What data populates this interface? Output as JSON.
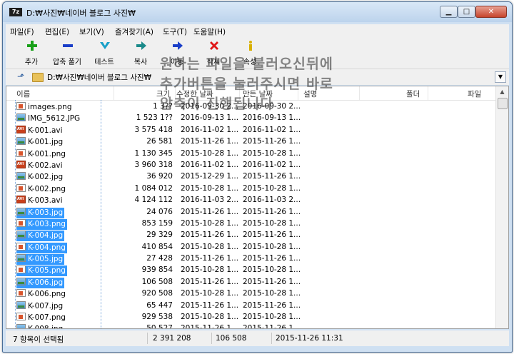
{
  "window": {
    "title": "D:₩사진₩네이버 블로그 사진₩",
    "app_icon": "7z"
  },
  "menu": [
    "파일(F)",
    "편집(E)",
    "보기(V)",
    "즐겨찾기(A)",
    "도구(T)",
    "도움말(H)"
  ],
  "toolbar": [
    {
      "label": "추가",
      "icon": "add-icon",
      "color": "#18a018"
    },
    {
      "label": "압축 풀기",
      "icon": "extract-icon",
      "color": "#1a3ec8"
    },
    {
      "label": "테스트",
      "icon": "test-icon",
      "color": "#18a0c8"
    },
    {
      "label": "복사",
      "icon": "copy-icon",
      "color": "#1a8a8a"
    },
    {
      "label": "이동",
      "icon": "move-icon",
      "color": "#1a3ec8"
    },
    {
      "label": "삭제",
      "icon": "delete-icon",
      "color": "#e01818"
    },
    {
      "label": "속성",
      "icon": "info-icon",
      "color": "#d8b000"
    }
  ],
  "address": {
    "path": "D:₩사진₩네이버 블로그 사진₩"
  },
  "columns": {
    "name": "이름",
    "size": "크기",
    "modified": "수정한 날짜",
    "created": "만든 날짜",
    "comment": "설명",
    "folders": "폴더",
    "files": "파일"
  },
  "files": [
    {
      "name": "images.png",
      "type": "png",
      "size": "1 3??",
      "modified": "2016-09-30 2...",
      "created": "2016-09-30 2...",
      "selected": false
    },
    {
      "name": "IMG_5612.JPG",
      "type": "jpg",
      "size": "1 523 1??",
      "modified": "2016-09-13 1...",
      "created": "2016-09-13 1...",
      "selected": false
    },
    {
      "name": "K-001.avi",
      "type": "avi",
      "size": "3 575 418",
      "modified": "2016-11-02 1...",
      "created": "2016-11-02 1...",
      "selected": false
    },
    {
      "name": "K-001.jpg",
      "type": "jpg",
      "size": "26 581",
      "modified": "2015-11-26 1...",
      "created": "2015-11-26 1...",
      "selected": false
    },
    {
      "name": "K-001.png",
      "type": "png",
      "size": "1 130 345",
      "modified": "2015-10-28 1...",
      "created": "2015-10-28 1...",
      "selected": false
    },
    {
      "name": "K-002.avi",
      "type": "avi",
      "size": "3 960 318",
      "modified": "2016-11-02 1...",
      "created": "2016-11-02 1...",
      "selected": false
    },
    {
      "name": "K-002.jpg",
      "type": "jpg",
      "size": "36 920",
      "modified": "2015-12-29 1...",
      "created": "2015-11-26 1...",
      "selected": false
    },
    {
      "name": "K-002.png",
      "type": "png",
      "size": "1 084 012",
      "modified": "2015-10-28 1...",
      "created": "2015-10-28 1...",
      "selected": false
    },
    {
      "name": "K-003.avi",
      "type": "avi",
      "size": "4 124 112",
      "modified": "2016-11-03 2...",
      "created": "2016-11-03 2...",
      "selected": false
    },
    {
      "name": "K-003.jpg",
      "type": "jpg",
      "size": "24 076",
      "modified": "2015-11-26 1...",
      "created": "2015-11-26 1...",
      "selected": true
    },
    {
      "name": "K-003.png",
      "type": "png",
      "size": "853 159",
      "modified": "2015-10-28 1...",
      "created": "2015-10-28 1...",
      "selected": true
    },
    {
      "name": "K-004.jpg",
      "type": "jpg",
      "size": "29 329",
      "modified": "2015-11-26 1...",
      "created": "2015-11-26 1...",
      "selected": true
    },
    {
      "name": "K-004.png",
      "type": "png",
      "size": "410 854",
      "modified": "2015-10-28 1...",
      "created": "2015-10-28 1...",
      "selected": true
    },
    {
      "name": "K-005.jpg",
      "type": "jpg",
      "size": "27 428",
      "modified": "2015-11-26 1...",
      "created": "2015-11-26 1...",
      "selected": true
    },
    {
      "name": "K-005.png",
      "type": "png",
      "size": "939 854",
      "modified": "2015-10-28 1...",
      "created": "2015-10-28 1...",
      "selected": true
    },
    {
      "name": "K-006.jpg",
      "type": "jpg",
      "size": "106 508",
      "modified": "2015-11-26 1...",
      "created": "2015-11-26 1...",
      "selected": true
    },
    {
      "name": "K-006.png",
      "type": "png",
      "size": "920 508",
      "modified": "2015-10-28 1...",
      "created": "2015-10-28 1...",
      "selected": false
    },
    {
      "name": "K-007.jpg",
      "type": "jpg",
      "size": "65 447",
      "modified": "2015-11-26 1...",
      "created": "2015-11-26 1...",
      "selected": false
    },
    {
      "name": "K-007.png",
      "type": "png",
      "size": "929 538",
      "modified": "2015-10-28 1...",
      "created": "2015-10-28 1...",
      "selected": false
    },
    {
      "name": "K-008.jpg",
      "type": "jpg",
      "size": "50 527",
      "modified": "2015-11-26 1...",
      "created": "2015-11-26 1...",
      "selected": false
    }
  ],
  "status": {
    "selection": "7 항목이 선택됨",
    "total_size": "2 391 208",
    "item_size": "106 508",
    "date": "2015-11-26 11:31"
  },
  "overlay": {
    "line1": "원하는 파일을 불러오신뒤에",
    "line2": "추가버튼을 눌러주시면 바로",
    "line3": "압축이 진행됩니다"
  }
}
